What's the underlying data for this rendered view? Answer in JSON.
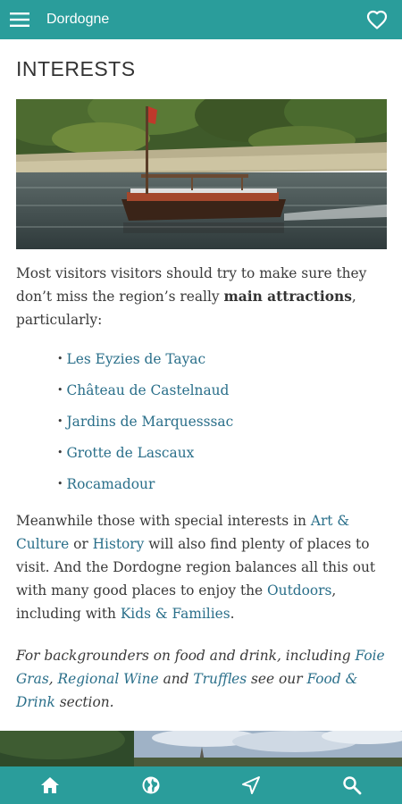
{
  "appbar": {
    "title": "Dordogne",
    "menu_icon": "hamburger-menu-icon",
    "favorite_icon": "heart-outline-icon"
  },
  "page": {
    "heading": "INTERESTS",
    "intro": {
      "part1": "Most visitors visitors should try to make sure they don’t miss the region’s really ",
      "bold": "main attractions",
      "part2": ", particularly:"
    },
    "attractions": [
      "Les Eyzies de Tayac",
      "Château de Castelnaud",
      "Jardins de Marquesssac",
      "Grotte de Lascaux",
      "Rocamadour"
    ],
    "para2": {
      "t1": "Meanwhile those with special interests in ",
      "l1": "Art & Culture",
      "t2": " or ",
      "l2": "History",
      "t3": " will also find plenty of places to visit. And the Dordogne region balances all this out with many good places to enjoy the ",
      "l3": "Outdoors",
      "t4": ", including with ",
      "l4": "Kids & Families",
      "t5": "."
    },
    "para3": {
      "t1": "For backgrounders on food and drink, including ",
      "l1": "Foie Gras",
      "t2": ", ",
      "l2": "Regional Wine",
      "t3": " and ",
      "l3": "Truffles",
      "t4": " see our ",
      "l4": "Food & Drink",
      "t5": " section."
    }
  },
  "bottom_nav": {
    "items": [
      "home-icon",
      "globe-icon",
      "navigation-arrow-icon",
      "search-icon"
    ]
  },
  "colors": {
    "teal": "#2a9d9b",
    "link": "#2a6f8a",
    "text": "#3a3a3a"
  }
}
